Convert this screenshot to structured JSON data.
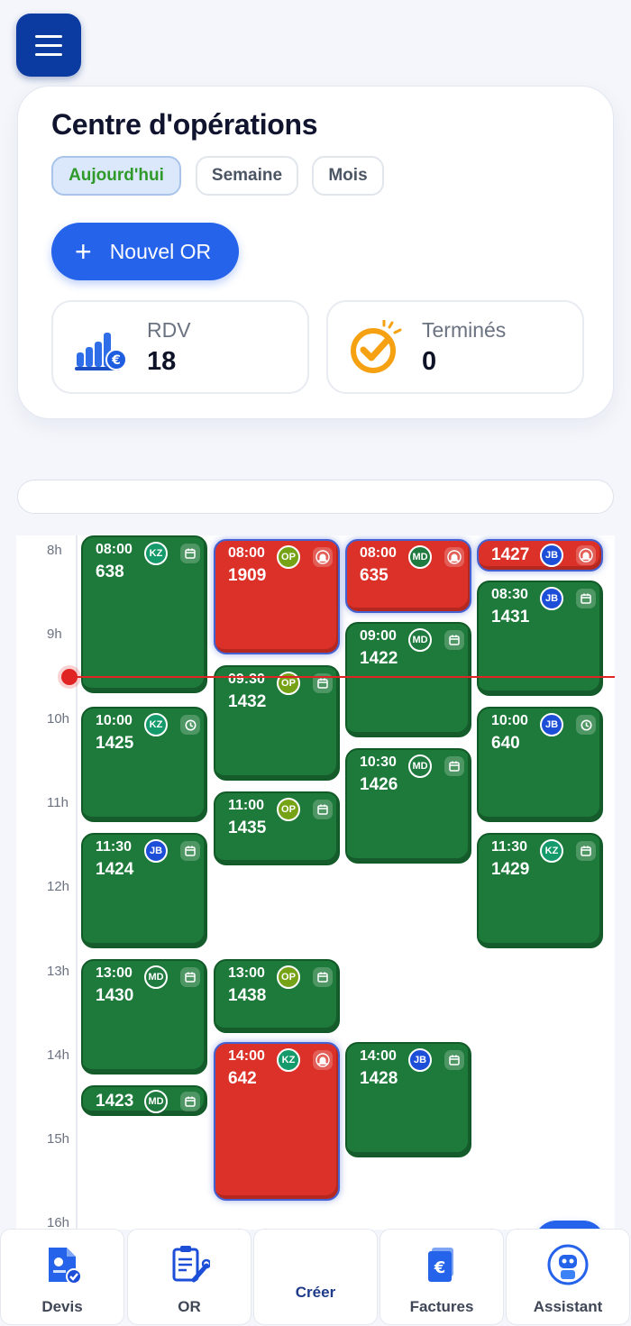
{
  "header": {
    "title": "Centre d'opérations"
  },
  "periods": [
    {
      "label": "Aujourd'hui",
      "active": true
    },
    {
      "label": "Semaine",
      "active": false
    },
    {
      "label": "Mois",
      "active": false
    }
  ],
  "new_or_label": "Nouvel OR",
  "stats": [
    {
      "label": "RDV",
      "value": "18",
      "icon": "revenue-chart-icon"
    },
    {
      "label": "Terminés",
      "value": "0",
      "icon": "check-badge-icon"
    }
  ],
  "calendar": {
    "hours": [
      "8h",
      "9h",
      "10h",
      "11h",
      "12h",
      "13h",
      "14h",
      "15h",
      "16h"
    ],
    "colors": {
      "ok": "#1d7a3a",
      "alert": "#dc3128"
    },
    "columns": [
      [
        {
          "time": "08:00",
          "number": "638",
          "tech": "KZ",
          "status": "ok",
          "icon": "calendar-icon"
        },
        {
          "time": "10:00",
          "number": "1425",
          "tech": "KZ",
          "status": "ok",
          "icon": "clock-icon"
        },
        {
          "time": "11:30",
          "number": "1424",
          "tech": "JB",
          "status": "ok",
          "icon": "calendar-icon"
        },
        {
          "time": "13:00",
          "number": "1430",
          "tech": "MD",
          "status": "ok",
          "icon": "calendar-icon"
        },
        {
          "time": "",
          "number": "1423",
          "tech": "MD",
          "status": "ok",
          "icon": "calendar-icon"
        }
      ],
      [
        {
          "time": "08:00",
          "number": "1909",
          "tech": "OP",
          "status": "alert",
          "icon": "alarm-icon"
        },
        {
          "time": "09:30",
          "number": "1432",
          "tech": "OP",
          "status": "ok",
          "icon": "calendar-icon"
        },
        {
          "time": "11:00",
          "number": "1435",
          "tech": "OP",
          "status": "ok",
          "icon": "calendar-icon"
        },
        {
          "time": "13:00",
          "number": "1438",
          "tech": "OP",
          "status": "ok",
          "icon": "calendar-icon"
        },
        {
          "time": "14:00",
          "number": "642",
          "tech": "KZ",
          "status": "alert",
          "icon": "alarm-icon"
        }
      ],
      [
        {
          "time": "08:00",
          "number": "635",
          "tech": "MD",
          "status": "alert",
          "icon": "alarm-icon"
        },
        {
          "time": "09:00",
          "number": "1422",
          "tech": "MD",
          "status": "ok",
          "icon": "calendar-icon"
        },
        {
          "time": "10:30",
          "number": "1426",
          "tech": "MD",
          "status": "ok",
          "icon": "calendar-icon"
        },
        {
          "time": "14:00",
          "number": "1428",
          "tech": "JB",
          "status": "ok",
          "icon": "calendar-icon"
        }
      ],
      [
        {
          "time": "",
          "number": "1427",
          "tech": "JB",
          "status": "alert",
          "icon": "alarm-icon"
        },
        {
          "time": "08:30",
          "number": "1431",
          "tech": "JB",
          "status": "ok",
          "icon": "calendar-icon"
        },
        {
          "time": "10:00",
          "number": "640",
          "tech": "JB",
          "status": "ok",
          "icon": "clock-icon"
        },
        {
          "time": "11:30",
          "number": "1429",
          "tech": "KZ",
          "status": "ok",
          "icon": "calendar-icon"
        }
      ]
    ],
    "tech_colors": {
      "KZ": "#159a6c",
      "OP": "#75a315",
      "MD": "#1f7a3f",
      "JB": "#1d4ed8"
    }
  },
  "bottom_nav": [
    {
      "label": "Devis",
      "icon": "quote-document-icon"
    },
    {
      "label": "OR",
      "icon": "clipboard-tools-icon"
    },
    {
      "label": "Créer",
      "icon": "plus-icon"
    },
    {
      "label": "Factures",
      "icon": "invoice-euro-icon"
    },
    {
      "label": "Assistant",
      "icon": "robot-assistant-icon"
    }
  ]
}
